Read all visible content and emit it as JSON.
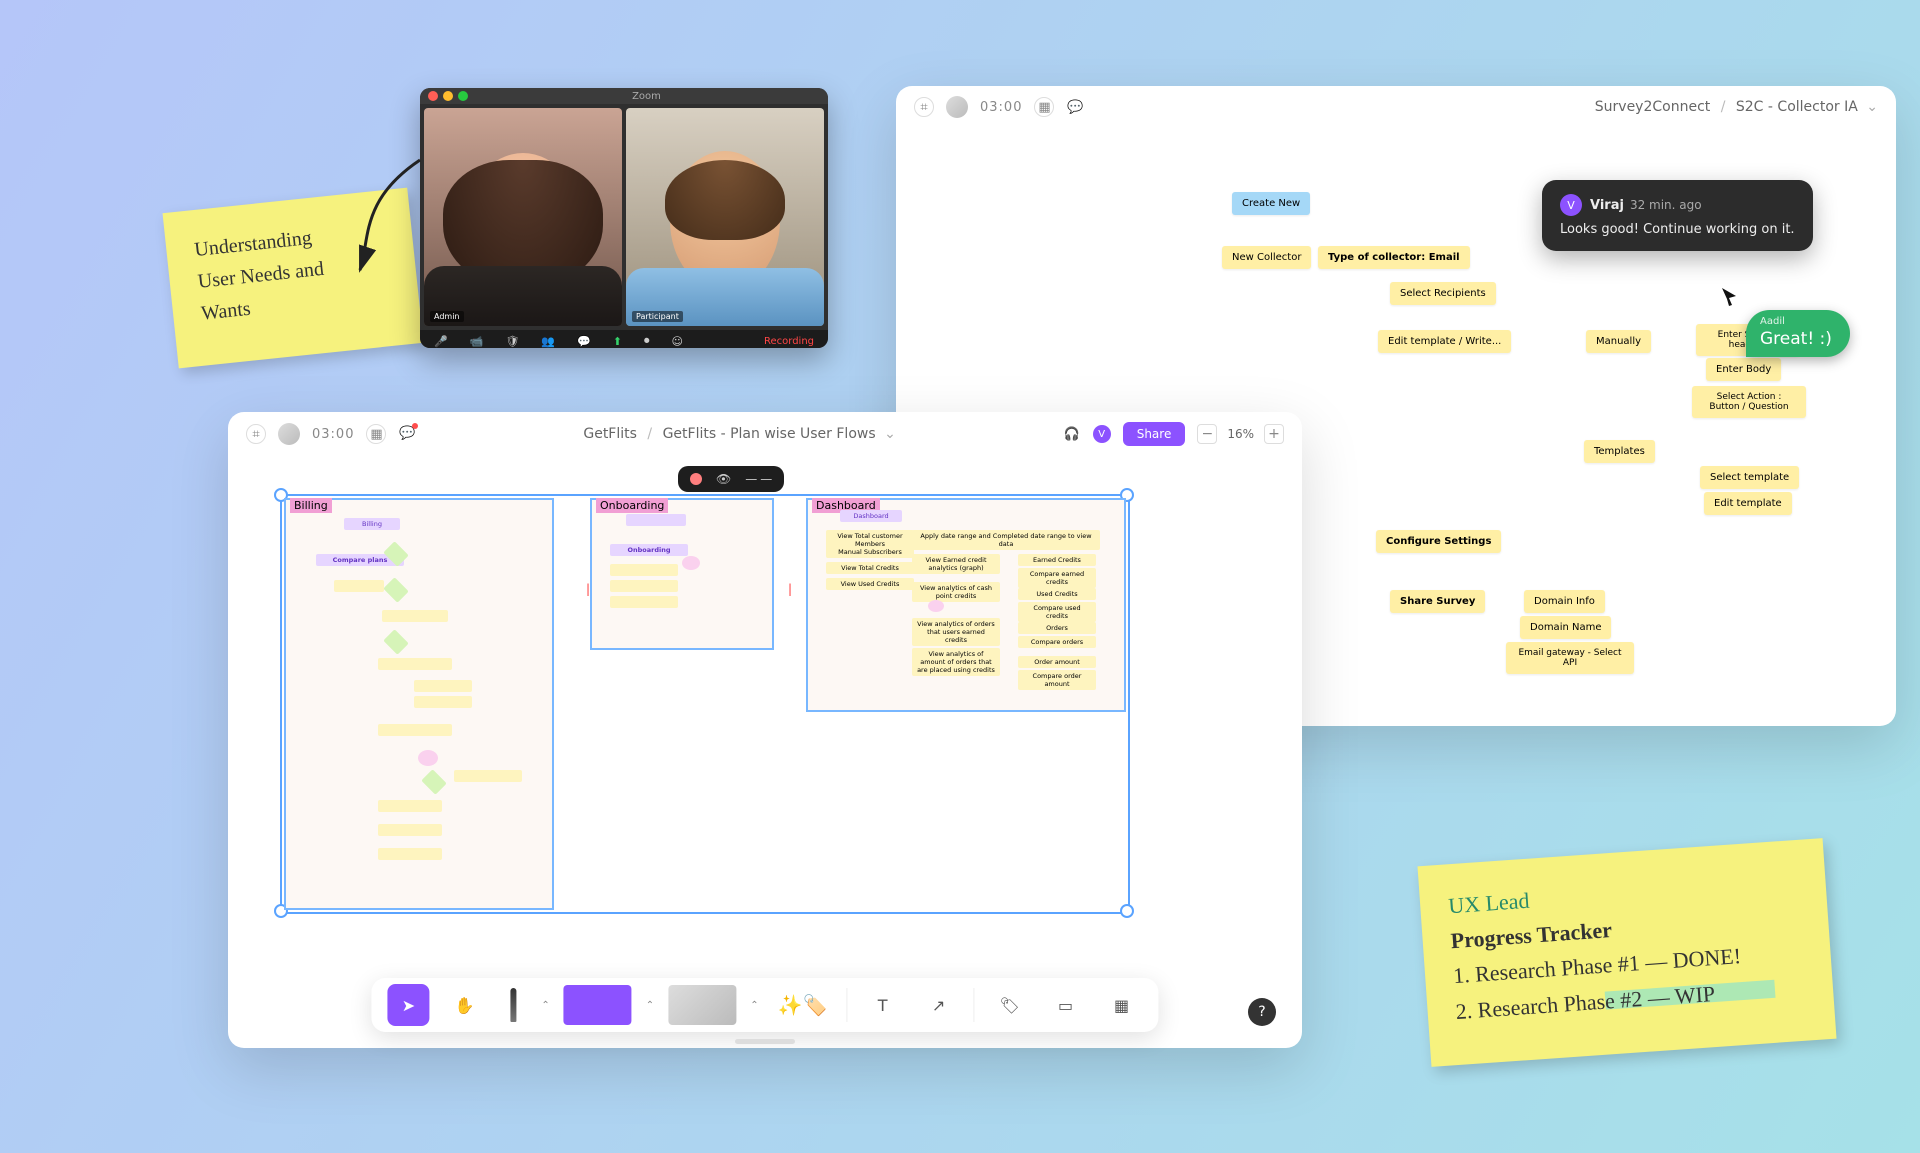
{
  "sticky1": {
    "l1": "Understanding",
    "l2": "User Needs and",
    "l3": "Wants"
  },
  "sticky2": {
    "role": "UX Lead",
    "title": "Progress Tracker",
    "line1": "1. Research Phase #1 — DONE!",
    "line2": "2. Research Phase #2 — WIP"
  },
  "zoom": {
    "title": "Zoom",
    "status": "Recording",
    "p1": "Admin",
    "p2": "Participant"
  },
  "panel_right": {
    "timer": "03:00",
    "crumb_root": "Survey2Connect",
    "crumb_file": "S2C - Collector IA",
    "nodes": {
      "create": "Create New",
      "collector": "New Collector",
      "type": "Type of collector: Email",
      "recipients": "Select Recipients",
      "edit": "Edit template / Write...",
      "manual": "Manually",
      "subject": "Enter Subject headline",
      "body": "Enter Body",
      "action": "Select Action : Button / Question",
      "templates": "Templates",
      "sel_tpl": "Select template",
      "edit_tpl": "Edit template",
      "config": "Configure Settings",
      "share": "Share Survey",
      "d_info": "Domain Info",
      "d_name": "Domain Name",
      "gateway": "Email gateway - Select API"
    }
  },
  "comment": {
    "author": "Viraj",
    "time": "32 min. ago",
    "body": "Looks good! Continue working on it.",
    "avatar": "V"
  },
  "tag": {
    "name": "Aadil",
    "text": "Great! :)"
  },
  "panel_left": {
    "timer": "03:00",
    "crumb_root": "GetFlits",
    "crumb_file": "GetFlits - Plan wise User Flows",
    "zoom": "16%",
    "share": "Share",
    "user_initial": "V",
    "frames": {
      "billing": "Billing",
      "onboarding": "Onboarding",
      "dashboard": "Dashboard"
    },
    "billing": {
      "head": "Billing",
      "step": "Compare plans"
    },
    "onboarding": {
      "head": "Onboarding"
    },
    "dashboard": {
      "head": "Dashboard",
      "row1": "Apply date range and Completed date range to view data",
      "a1": "View Total customer Members",
      "a2": "Manual Subscribers",
      "a3": "View Total Credits",
      "a4": "View Used Credits",
      "b1": "View Earned credit analytics (graph)",
      "b2": "View analytics of cash point credits",
      "b3": "View analytics of orders that users earned credits",
      "b4": "View analytics of amount of orders that are placed using credits",
      "c1": "Earned Credits",
      "c2": "Compare earned credits",
      "c3": "Used Credits",
      "c4": "Compare used credits",
      "c5": "Orders",
      "c6": "Compare orders",
      "c7": "Order amount",
      "c8": "Compare order amount"
    },
    "help": "?"
  }
}
